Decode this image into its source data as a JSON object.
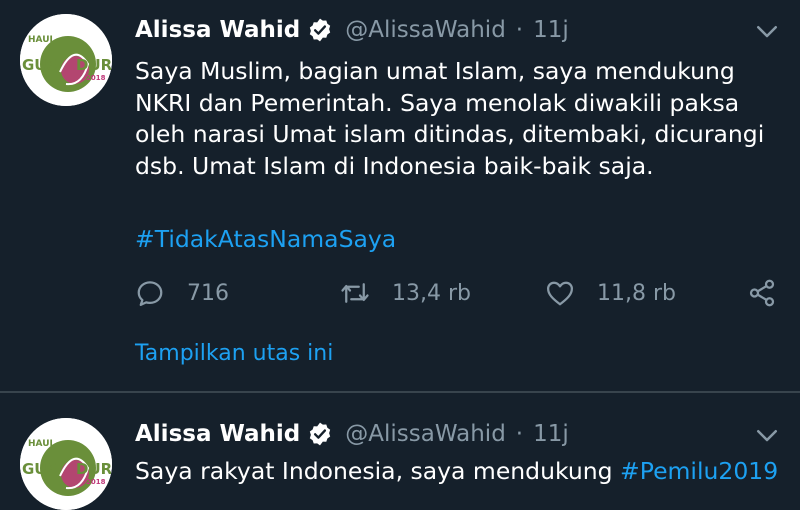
{
  "tweets": [
    {
      "avatar_text": {
        "top": "HAUL",
        "left": "GUS",
        "right": "DUR",
        "year": "2018"
      },
      "name": "Alissa Wahid",
      "handle": "@AlissaWahid",
      "separator": "·",
      "time": "11j",
      "body_lines": [
        "Saya Muslim, bagian umat Islam, saya mendukung",
        "NKRI dan Pemerintah. Saya menolak diwakili paksa",
        "oleh narasi Umat islam ditindas, ditembaki, dicurangi",
        "dsb. Umat Islam di Indonesia baik-baik saja."
      ],
      "hashtag": "#TidakAtasNamaSaya",
      "reply_count": "716",
      "retweet_count": "13,4 rb",
      "like_count": "11,8 rb",
      "thread_link": "Tampilkan utas ini"
    },
    {
      "avatar_text": {
        "top": "HAUL",
        "left": "GUS",
        "right": "DUR",
        "year": "2018"
      },
      "name": "Alissa Wahid",
      "handle": "@AlissaWahid",
      "separator": "·",
      "time": "11j",
      "body_text": "Saya rakyat Indonesia, saya mendukung ",
      "body_hashtag": "#Pemilu2019"
    }
  ],
  "colors": {
    "background": "#15202b",
    "text_primary": "#ffffff",
    "text_secondary": "#8899a6",
    "link": "#1da1f2",
    "divider": "#38444d",
    "avatar_green": "#6a8f3a",
    "avatar_pink": "#c0397a"
  },
  "icons": [
    "verified-badge-icon",
    "chevron-down-icon",
    "reply-icon",
    "retweet-icon",
    "like-icon",
    "share-icon"
  ]
}
